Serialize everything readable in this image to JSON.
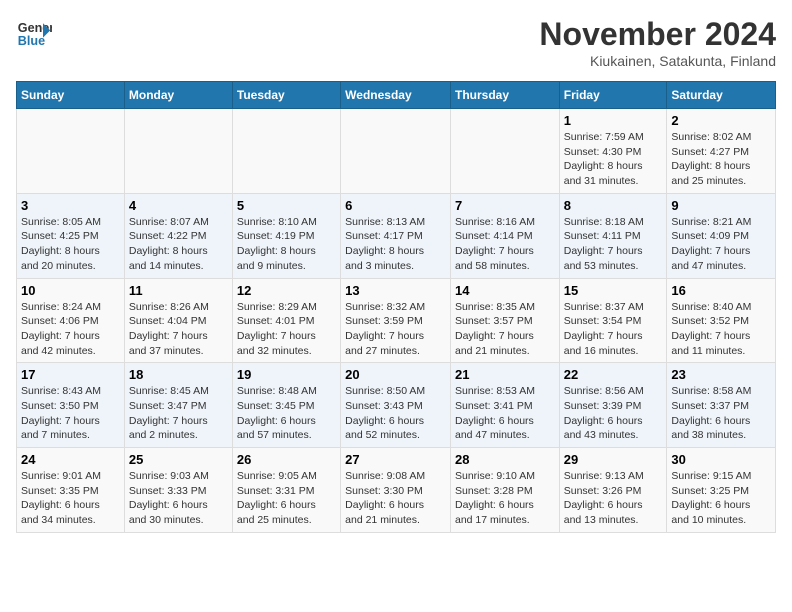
{
  "logo": {
    "line1": "General",
    "line2": "Blue"
  },
  "title": "November 2024",
  "subtitle": "Kiukainen, Satakunta, Finland",
  "days_of_week": [
    "Sunday",
    "Monday",
    "Tuesday",
    "Wednesday",
    "Thursday",
    "Friday",
    "Saturday"
  ],
  "weeks": [
    [
      {
        "day": "",
        "info": ""
      },
      {
        "day": "",
        "info": ""
      },
      {
        "day": "",
        "info": ""
      },
      {
        "day": "",
        "info": ""
      },
      {
        "day": "",
        "info": ""
      },
      {
        "day": "1",
        "info": "Sunrise: 7:59 AM\nSunset: 4:30 PM\nDaylight: 8 hours\nand 31 minutes."
      },
      {
        "day": "2",
        "info": "Sunrise: 8:02 AM\nSunset: 4:27 PM\nDaylight: 8 hours\nand 25 minutes."
      }
    ],
    [
      {
        "day": "3",
        "info": "Sunrise: 8:05 AM\nSunset: 4:25 PM\nDaylight: 8 hours\nand 20 minutes."
      },
      {
        "day": "4",
        "info": "Sunrise: 8:07 AM\nSunset: 4:22 PM\nDaylight: 8 hours\nand 14 minutes."
      },
      {
        "day": "5",
        "info": "Sunrise: 8:10 AM\nSunset: 4:19 PM\nDaylight: 8 hours\nand 9 minutes."
      },
      {
        "day": "6",
        "info": "Sunrise: 8:13 AM\nSunset: 4:17 PM\nDaylight: 8 hours\nand 3 minutes."
      },
      {
        "day": "7",
        "info": "Sunrise: 8:16 AM\nSunset: 4:14 PM\nDaylight: 7 hours\nand 58 minutes."
      },
      {
        "day": "8",
        "info": "Sunrise: 8:18 AM\nSunset: 4:11 PM\nDaylight: 7 hours\nand 53 minutes."
      },
      {
        "day": "9",
        "info": "Sunrise: 8:21 AM\nSunset: 4:09 PM\nDaylight: 7 hours\nand 47 minutes."
      }
    ],
    [
      {
        "day": "10",
        "info": "Sunrise: 8:24 AM\nSunset: 4:06 PM\nDaylight: 7 hours\nand 42 minutes."
      },
      {
        "day": "11",
        "info": "Sunrise: 8:26 AM\nSunset: 4:04 PM\nDaylight: 7 hours\nand 37 minutes."
      },
      {
        "day": "12",
        "info": "Sunrise: 8:29 AM\nSunset: 4:01 PM\nDaylight: 7 hours\nand 32 minutes."
      },
      {
        "day": "13",
        "info": "Sunrise: 8:32 AM\nSunset: 3:59 PM\nDaylight: 7 hours\nand 27 minutes."
      },
      {
        "day": "14",
        "info": "Sunrise: 8:35 AM\nSunset: 3:57 PM\nDaylight: 7 hours\nand 21 minutes."
      },
      {
        "day": "15",
        "info": "Sunrise: 8:37 AM\nSunset: 3:54 PM\nDaylight: 7 hours\nand 16 minutes."
      },
      {
        "day": "16",
        "info": "Sunrise: 8:40 AM\nSunset: 3:52 PM\nDaylight: 7 hours\nand 11 minutes."
      }
    ],
    [
      {
        "day": "17",
        "info": "Sunrise: 8:43 AM\nSunset: 3:50 PM\nDaylight: 7 hours\nand 7 minutes."
      },
      {
        "day": "18",
        "info": "Sunrise: 8:45 AM\nSunset: 3:47 PM\nDaylight: 7 hours\nand 2 minutes."
      },
      {
        "day": "19",
        "info": "Sunrise: 8:48 AM\nSunset: 3:45 PM\nDaylight: 6 hours\nand 57 minutes."
      },
      {
        "day": "20",
        "info": "Sunrise: 8:50 AM\nSunset: 3:43 PM\nDaylight: 6 hours\nand 52 minutes."
      },
      {
        "day": "21",
        "info": "Sunrise: 8:53 AM\nSunset: 3:41 PM\nDaylight: 6 hours\nand 47 minutes."
      },
      {
        "day": "22",
        "info": "Sunrise: 8:56 AM\nSunset: 3:39 PM\nDaylight: 6 hours\nand 43 minutes."
      },
      {
        "day": "23",
        "info": "Sunrise: 8:58 AM\nSunset: 3:37 PM\nDaylight: 6 hours\nand 38 minutes."
      }
    ],
    [
      {
        "day": "24",
        "info": "Sunrise: 9:01 AM\nSunset: 3:35 PM\nDaylight: 6 hours\nand 34 minutes."
      },
      {
        "day": "25",
        "info": "Sunrise: 9:03 AM\nSunset: 3:33 PM\nDaylight: 6 hours\nand 30 minutes."
      },
      {
        "day": "26",
        "info": "Sunrise: 9:05 AM\nSunset: 3:31 PM\nDaylight: 6 hours\nand 25 minutes."
      },
      {
        "day": "27",
        "info": "Sunrise: 9:08 AM\nSunset: 3:30 PM\nDaylight: 6 hours\nand 21 minutes."
      },
      {
        "day": "28",
        "info": "Sunrise: 9:10 AM\nSunset: 3:28 PM\nDaylight: 6 hours\nand 17 minutes."
      },
      {
        "day": "29",
        "info": "Sunrise: 9:13 AM\nSunset: 3:26 PM\nDaylight: 6 hours\nand 13 minutes."
      },
      {
        "day": "30",
        "info": "Sunrise: 9:15 AM\nSunset: 3:25 PM\nDaylight: 6 hours\nand 10 minutes."
      }
    ]
  ]
}
